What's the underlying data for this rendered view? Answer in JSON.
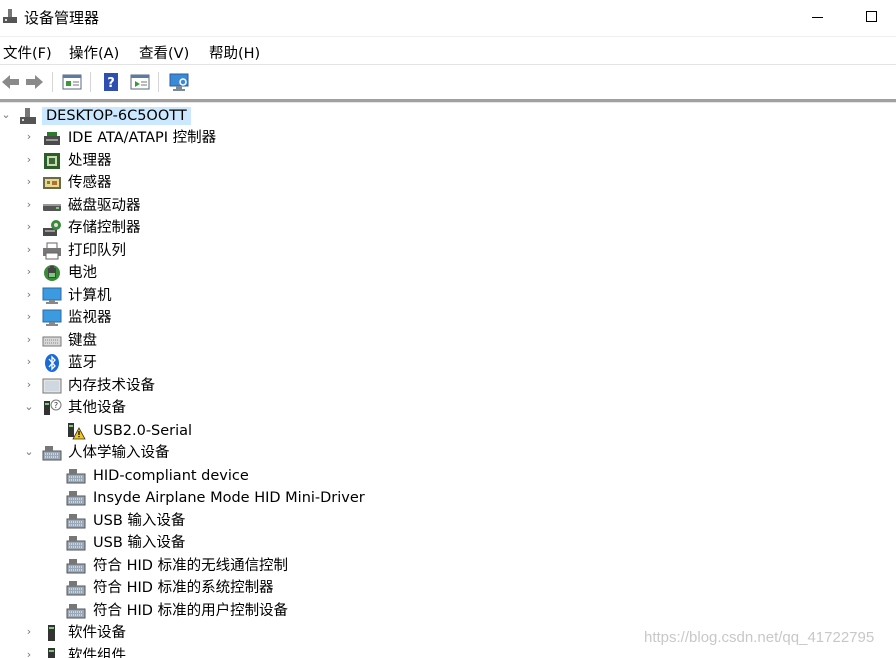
{
  "window": {
    "title": "设备管理器"
  },
  "menu": [
    "文件(F)",
    "操作(A)",
    "查看(V)",
    "帮助(H)"
  ],
  "toolbar": {
    "icons": [
      "back-arrow-icon",
      "forward-arrow-icon",
      "properties-icon",
      "help-icon",
      "update-driver-icon",
      "scan-hardware-icon"
    ]
  },
  "tree": {
    "root": "DESKTOP-6C5OOTT",
    "categories": [
      "IDE ATA/ATAPI 控制器",
      "处理器",
      "传感器",
      "磁盘驱动器",
      "存储控制器",
      "打印队列",
      "电池",
      "计算机",
      "监视器",
      "键盘",
      "蓝牙",
      "内存技术设备",
      "其他设备",
      "人体学输入设备",
      "软件设备",
      "软件组件"
    ],
    "other_devices": [
      "USB2.0-Serial"
    ],
    "hid_devices": [
      "HID-compliant device",
      "Insyde Airplane Mode HID Mini-Driver",
      "USB 输入设备",
      "USB 输入设备",
      "符合 HID 标准的无线通信控制",
      "符合 HID 标准的系统控制器",
      "符合 HID 标准的用户控制设备"
    ]
  },
  "watermark": "https://blog.csdn.net/qq_41722795"
}
